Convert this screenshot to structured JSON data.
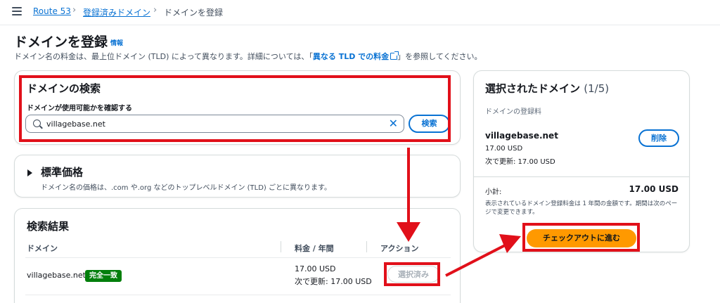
{
  "breadcrumb": {
    "items": [
      "Route 53",
      "登録済みドメイン",
      "ドメインを登録"
    ]
  },
  "header": {
    "title": "ドメインを登録",
    "info_link": "情報",
    "description_pre": "ドメイン名の料金は、最上位ドメイン (TLD) によって異なります。詳細については、「",
    "description_link": "異なる TLD での料金",
    "description_post": "」を参照してください。"
  },
  "search": {
    "title": "ドメインの検索",
    "label": "ドメインが使用可能かを確認する",
    "value": "villagebase.net",
    "button": "検索"
  },
  "standard_pricing": {
    "title": "標準価格",
    "description": "ドメイン名の価格は、.com や.org などのトップレベルドメイン (TLD) ごとに異なります。"
  },
  "results": {
    "title": "検索結果",
    "columns": [
      "ドメイン",
      "料金 / 年間",
      "アクション"
    ],
    "rows": [
      {
        "domain": "villagebase.net",
        "badge": "完全一致",
        "price": "17.00 USD",
        "renewal": "次で更新: 17.00 USD",
        "action": "選択済み"
      }
    ]
  },
  "selected": {
    "title": "選択されたドメイン",
    "count": "(1/5)",
    "subtitle": "ドメインの登録料",
    "domain": "villagebase.net",
    "price": "17.00 USD",
    "renewal": "次で更新: 17.00 USD",
    "remove_button": "削除",
    "subtotal_label": "小計:",
    "subtotal_value": "17.00 USD",
    "note": "表示されているドメイン登録料金は 1 年間の金額です。期間は次のページで変更できます。",
    "checkout_button": "チェックアウトに進む"
  },
  "colors": {
    "annotation": "#e1101a",
    "link": "#0972d3",
    "primary_button": "#ff9900",
    "badge": "#037f0c"
  }
}
